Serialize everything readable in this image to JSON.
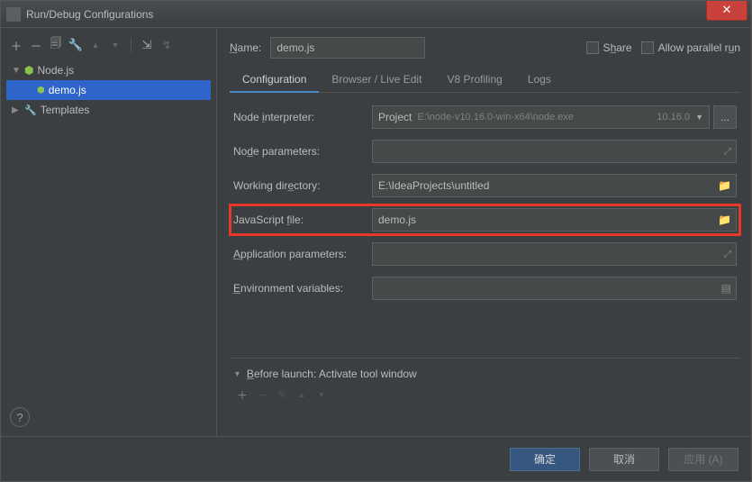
{
  "window": {
    "title": "Run/Debug Configurations"
  },
  "nameRow": {
    "label": "Name:",
    "value": "demo.js",
    "share": "Share",
    "allowParallel": "Allow parallel run"
  },
  "tree": {
    "nodejs": {
      "label": "Node.js"
    },
    "demo": {
      "label": "demo.js"
    },
    "templates": {
      "label": "Templates"
    }
  },
  "tabs": {
    "configuration": "Configuration",
    "browser": "Browser / Live Edit",
    "v8": "V8 Profiling",
    "logs": "Logs"
  },
  "form": {
    "nodeInterpreter": {
      "label": "Node interpreter:",
      "project": "Project",
      "path": "E:\\node-v10.16.0-win-x64\\node.exe",
      "version": "10.16.0"
    },
    "nodeParams": {
      "label": "Node parameters:",
      "value": ""
    },
    "workingDir": {
      "label": "Working directory:",
      "value": "E:\\IdeaProjects\\untitled"
    },
    "jsFile": {
      "label": "JavaScript file:",
      "value": "demo.js"
    },
    "appParams": {
      "label": "Application parameters:",
      "value": ""
    },
    "envVars": {
      "label": "Environment variables:",
      "value": ""
    }
  },
  "beforeLaunch": {
    "header": "Before launch: Activate tool window"
  },
  "footer": {
    "ok": "确定",
    "cancel": "取消",
    "apply": "应用 (A)"
  },
  "help": {
    "glyph": "?"
  },
  "icons": {
    "plus": "＋",
    "minus": "－",
    "copy": "🗐",
    "wrench": "🔧",
    "up": "▲",
    "down": "▼",
    "folder": "📁",
    "expand": "⤢",
    "list": "▤",
    "caret_down": "▼",
    "caret_right": "▶",
    "close_x": "✕",
    "pencil": "✎",
    "ellipsis": "...",
    "l1": "⇲",
    "l2": "↯"
  }
}
